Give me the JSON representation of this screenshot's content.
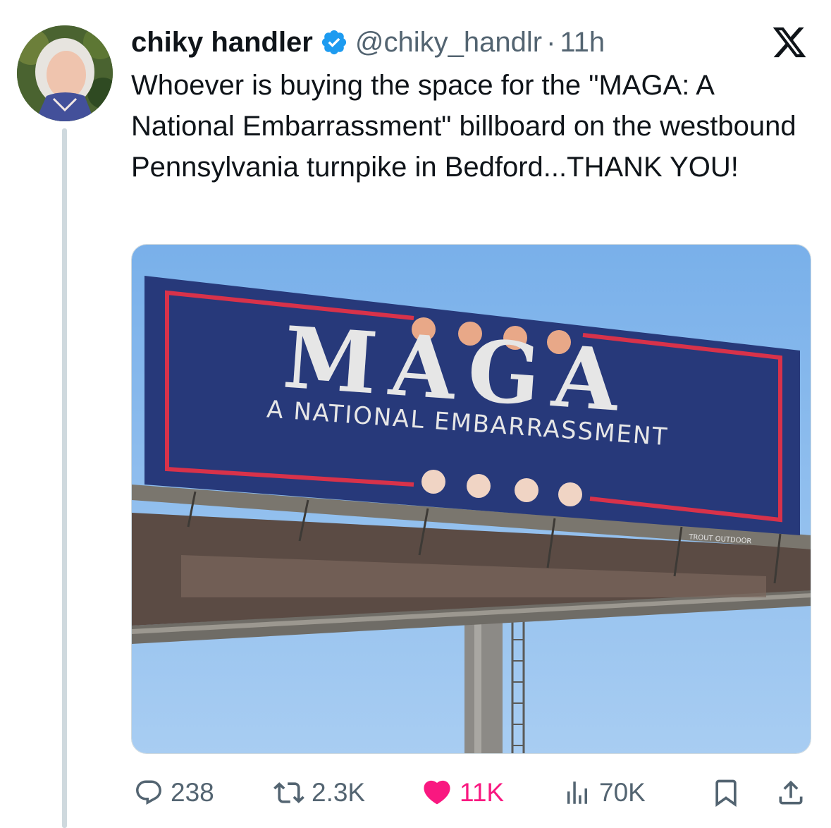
{
  "author": {
    "display_name": "chiky handler",
    "handle": "@chiky_handlr",
    "separator": "·",
    "time": "11h",
    "verified_icon": "verified-badge-icon"
  },
  "post": {
    "text": "Whoever is buying the space for the \"MAGA: A National Embarrassment\" billboard on the westbound Pennsylvania turnpike in Bedford...THANK YOU!"
  },
  "media": {
    "billboard_headline": "MAGA",
    "billboard_subline": "A NATIONAL EMBARRASSMENT",
    "billboard_vendor": "TROUT OUTDOOR"
  },
  "actions": {
    "replies": "238",
    "reposts": "2.3K",
    "likes": "11K",
    "views": "70K"
  },
  "colors": {
    "like_pink": "#f91880",
    "verified_blue": "#1d9bf0",
    "muted_gray": "#536471",
    "billboard_blue": "#27397a",
    "billboard_red": "#d8324a"
  },
  "icons": [
    "x-logo-icon",
    "reply-icon",
    "repost-icon",
    "heart-icon",
    "views-icon",
    "bookmark-icon",
    "share-icon"
  ]
}
